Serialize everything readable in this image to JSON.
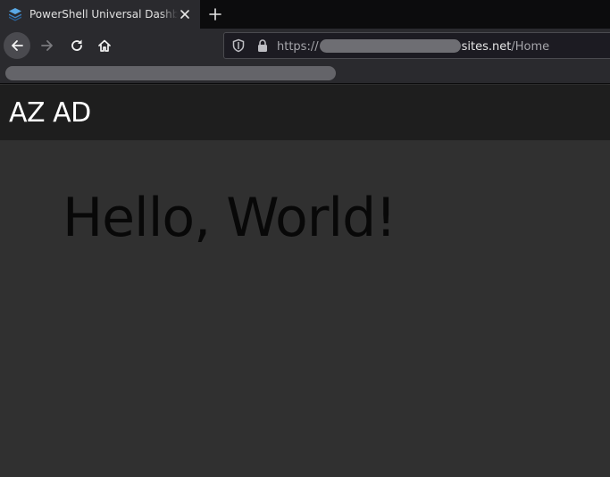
{
  "browser": {
    "tab": {
      "title": "PowerShell Universal Dashboard",
      "favicon": "layers-icon"
    },
    "nav": {
      "back": "back-arrow-icon",
      "forward": "forward-arrow-icon",
      "reload": "reload-icon",
      "home": "home-icon"
    },
    "url": {
      "scheme": "https://",
      "host_suffix": "sites.net",
      "path": "/Home"
    }
  },
  "app": {
    "title": "AZ AD",
    "heading": "Hello, World!"
  },
  "colors": {
    "app_bar": "#1e1e1e",
    "page_bg": "#303030",
    "heading": "#080808",
    "title": "#ffffff"
  }
}
